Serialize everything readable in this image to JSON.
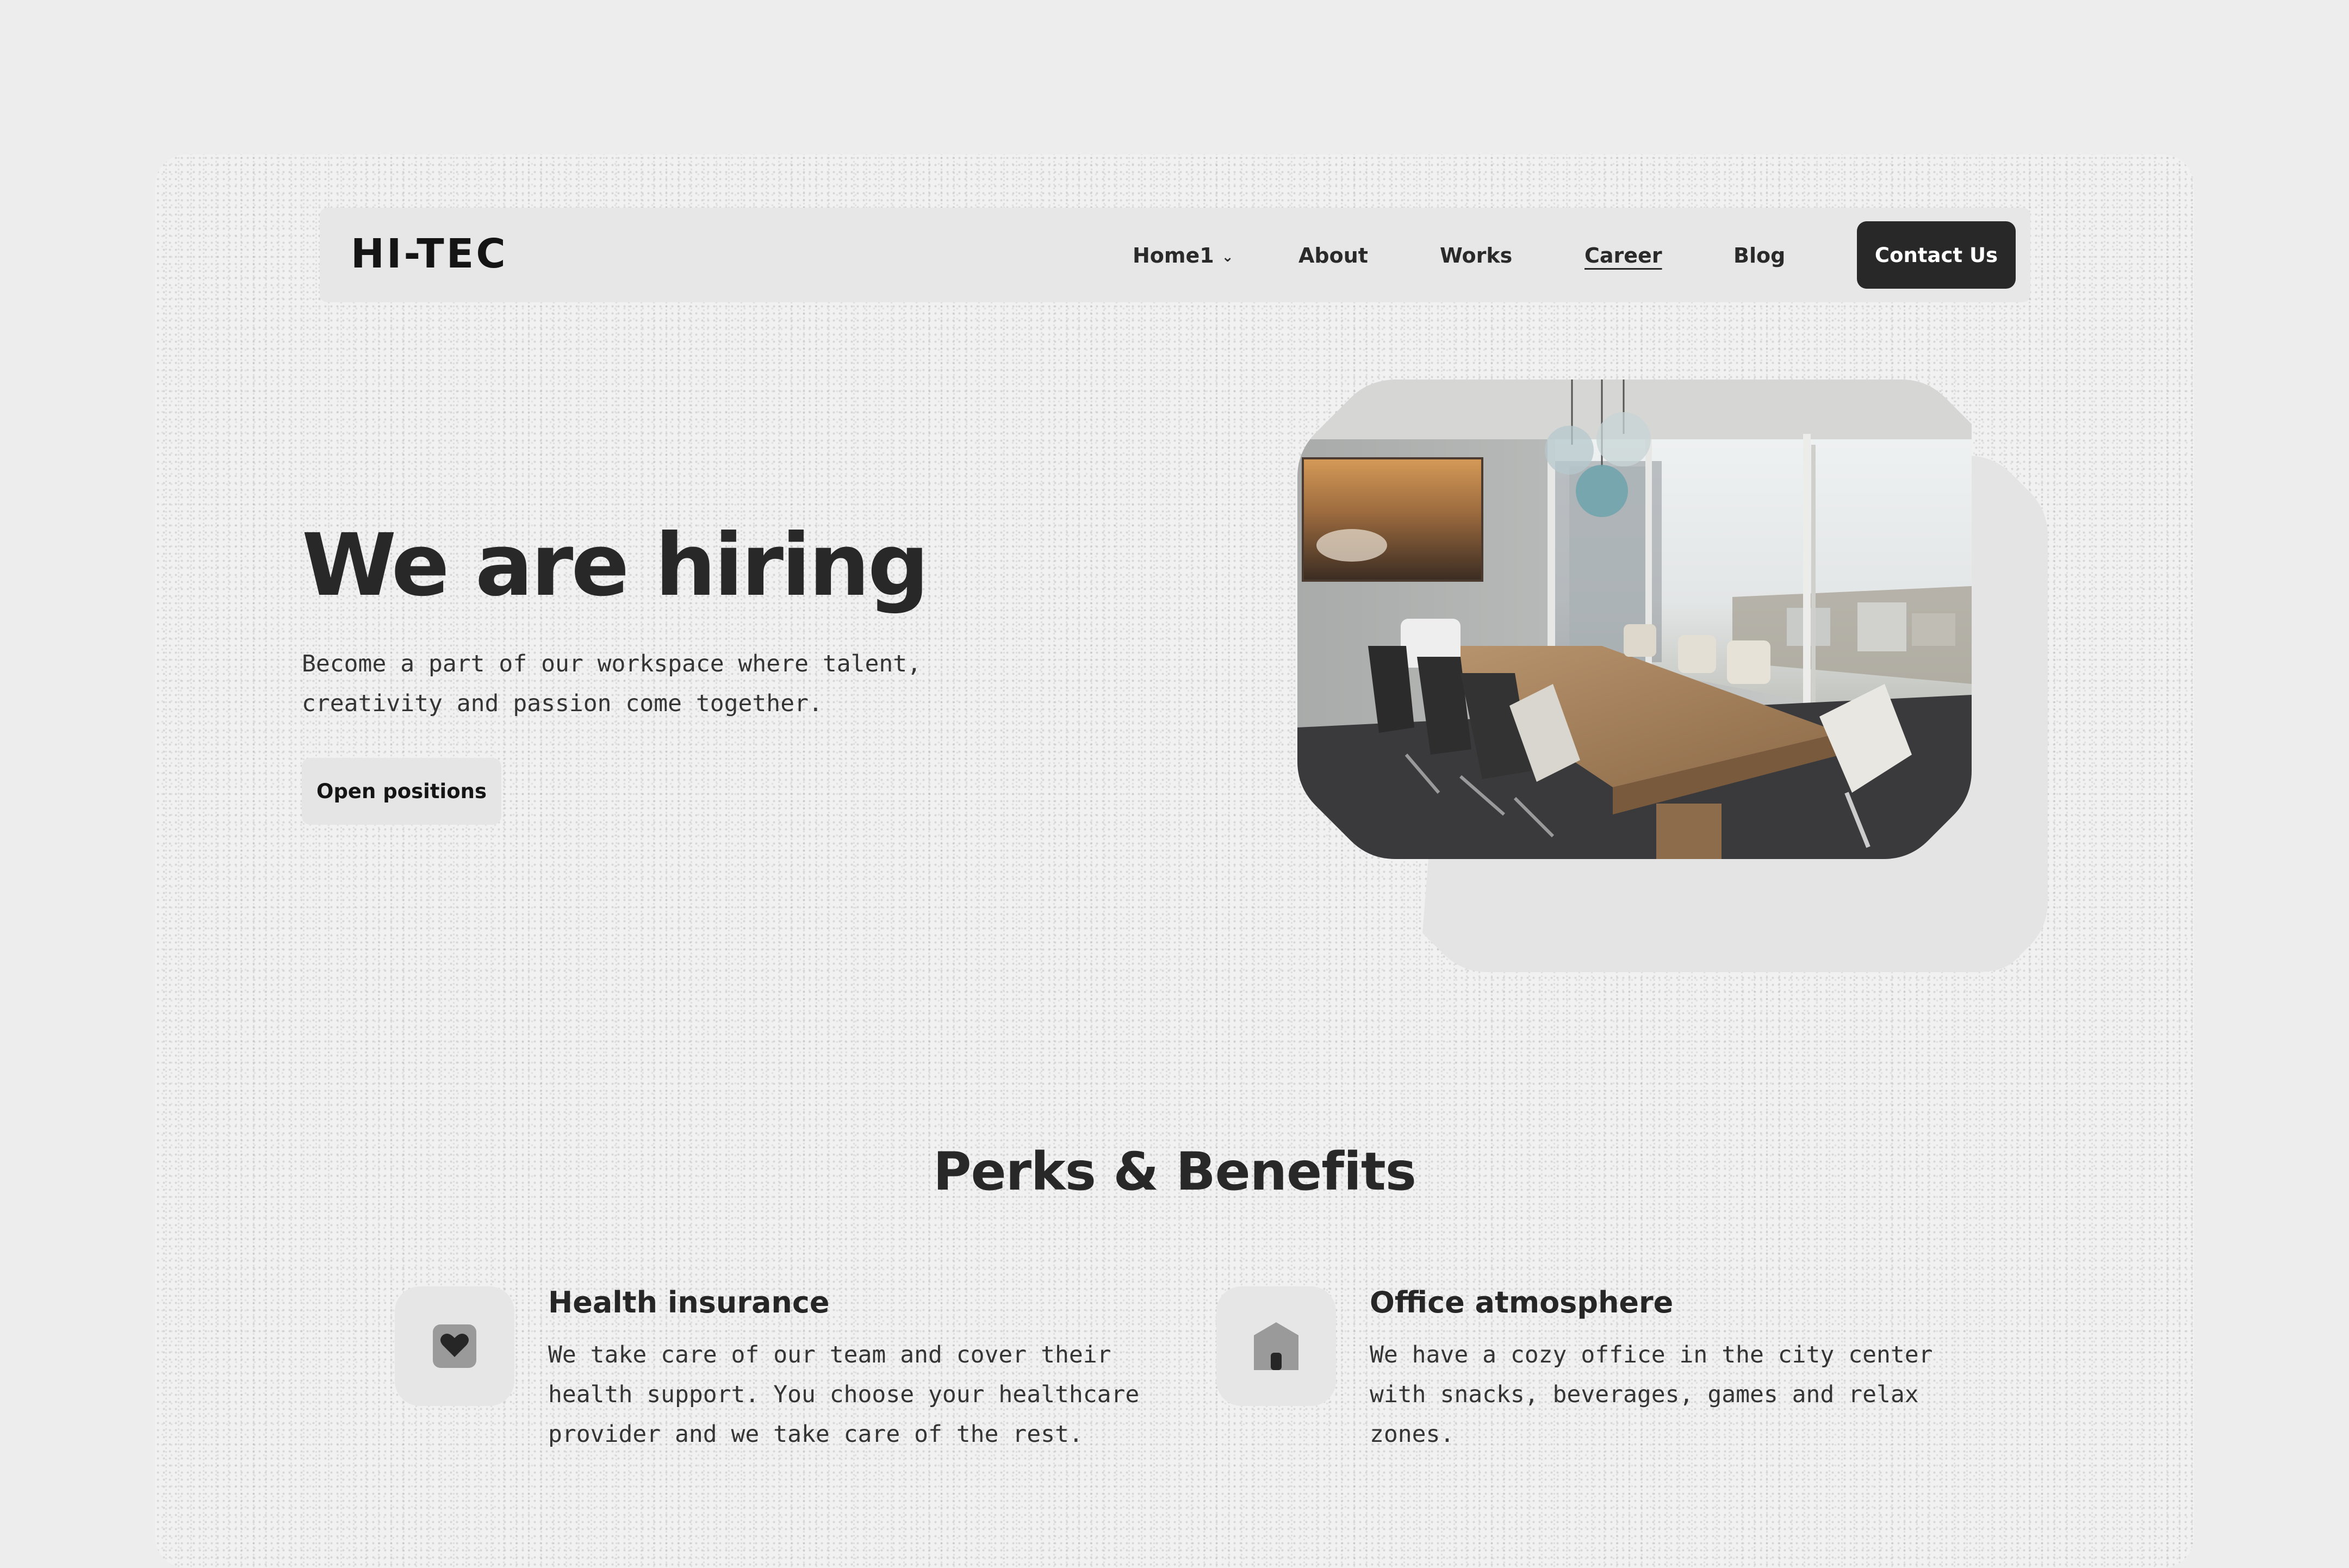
{
  "brand": {
    "logo": "HI-TEC"
  },
  "nav": {
    "home": "Home1",
    "about": "About",
    "works": "Works",
    "career": "Career",
    "blog": "Blog",
    "contact": "Contact Us"
  },
  "hero": {
    "title": "We are hiring",
    "subtitle": "Become a part of our workspace where talent, creativity and passion come together.",
    "cta": "Open positions"
  },
  "perks": {
    "title": "Perks & Benefits",
    "items": [
      {
        "icon": "heart-icon",
        "title": "Health insurance",
        "description": "We take care of our team and cover their health support. You choose your healthcare provider and we take care of the rest."
      },
      {
        "icon": "house-icon",
        "title": "Office atmosphere",
        "description": "We have a cozy office in the city center with snacks, beverages, games and relax zones."
      }
    ]
  },
  "colors": {
    "page": "#ededee",
    "card": "#f1f1f1",
    "dark": "#282828",
    "accent_button": "#282828",
    "button_light": "#e5e5e6"
  }
}
